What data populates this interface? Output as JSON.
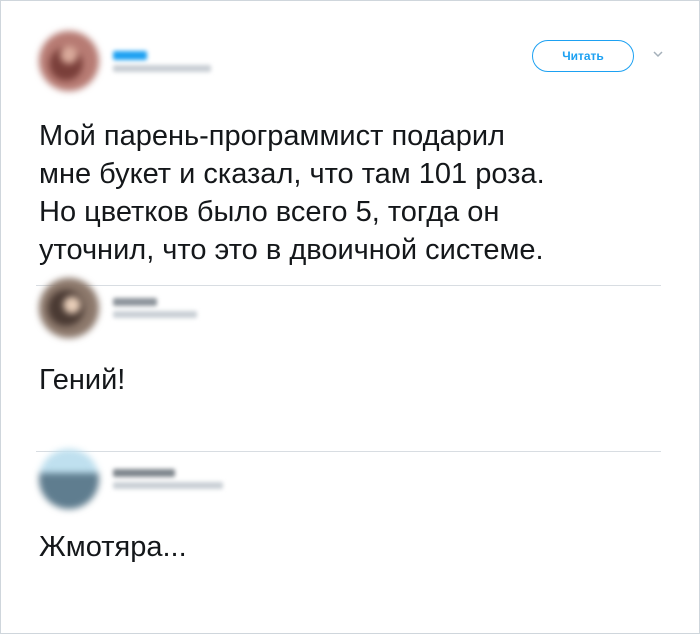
{
  "main_tweet": {
    "follow_label": "Читать",
    "text": "Мой парень-программист подарил\nмне букет и сказал, что там 101 роза.\nНо цветков было всего 5, тогда он\nуточнил, что это в двоичной системе.",
    "icons": [
      "avatar",
      "chevron-down-icon"
    ]
  },
  "replies": [
    {
      "text": "Гений!"
    },
    {
      "text": "Жмотяра..."
    }
  ],
  "colors": {
    "accent": "#1da1f2",
    "text": "#14171a",
    "divider": "#d8dde2"
  }
}
